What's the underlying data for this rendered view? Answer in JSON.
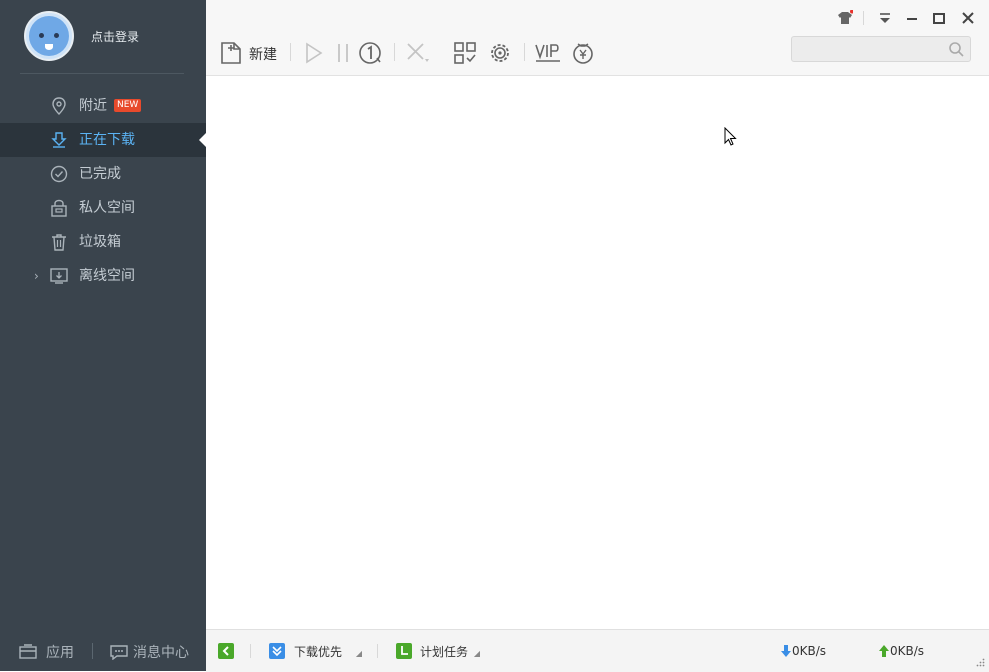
{
  "user": {
    "login_label": "点击登录"
  },
  "sidebar": {
    "items": [
      {
        "label": "附近",
        "icon": "location-pin-icon",
        "badge": "NEW"
      },
      {
        "label": "正在下载",
        "icon": "download-arrow-icon",
        "active": true
      },
      {
        "label": "已完成",
        "icon": "check-circle-icon"
      },
      {
        "label": "私人空间",
        "icon": "lock-folder-icon"
      },
      {
        "label": "垃圾箱",
        "icon": "trash-icon"
      },
      {
        "label": "离线空间",
        "icon": "offline-space-icon",
        "expandable": true
      }
    ],
    "bottom": {
      "apps_label": "应用",
      "messages_label": "消息中心"
    }
  },
  "toolbar": {
    "new_label": "新建"
  },
  "search": {
    "placeholder": "",
    "value": ""
  },
  "statusbar": {
    "priority_label": "下载优先",
    "schedule_label": "计划任务",
    "download_speed": "0KB/s",
    "upload_speed": "0KB/s"
  },
  "colors": {
    "sidebar_bg": "#3a444d",
    "accent_blue": "#5bb3f4",
    "badge_red": "#e84a2c",
    "status_green": "#4aa82a"
  }
}
